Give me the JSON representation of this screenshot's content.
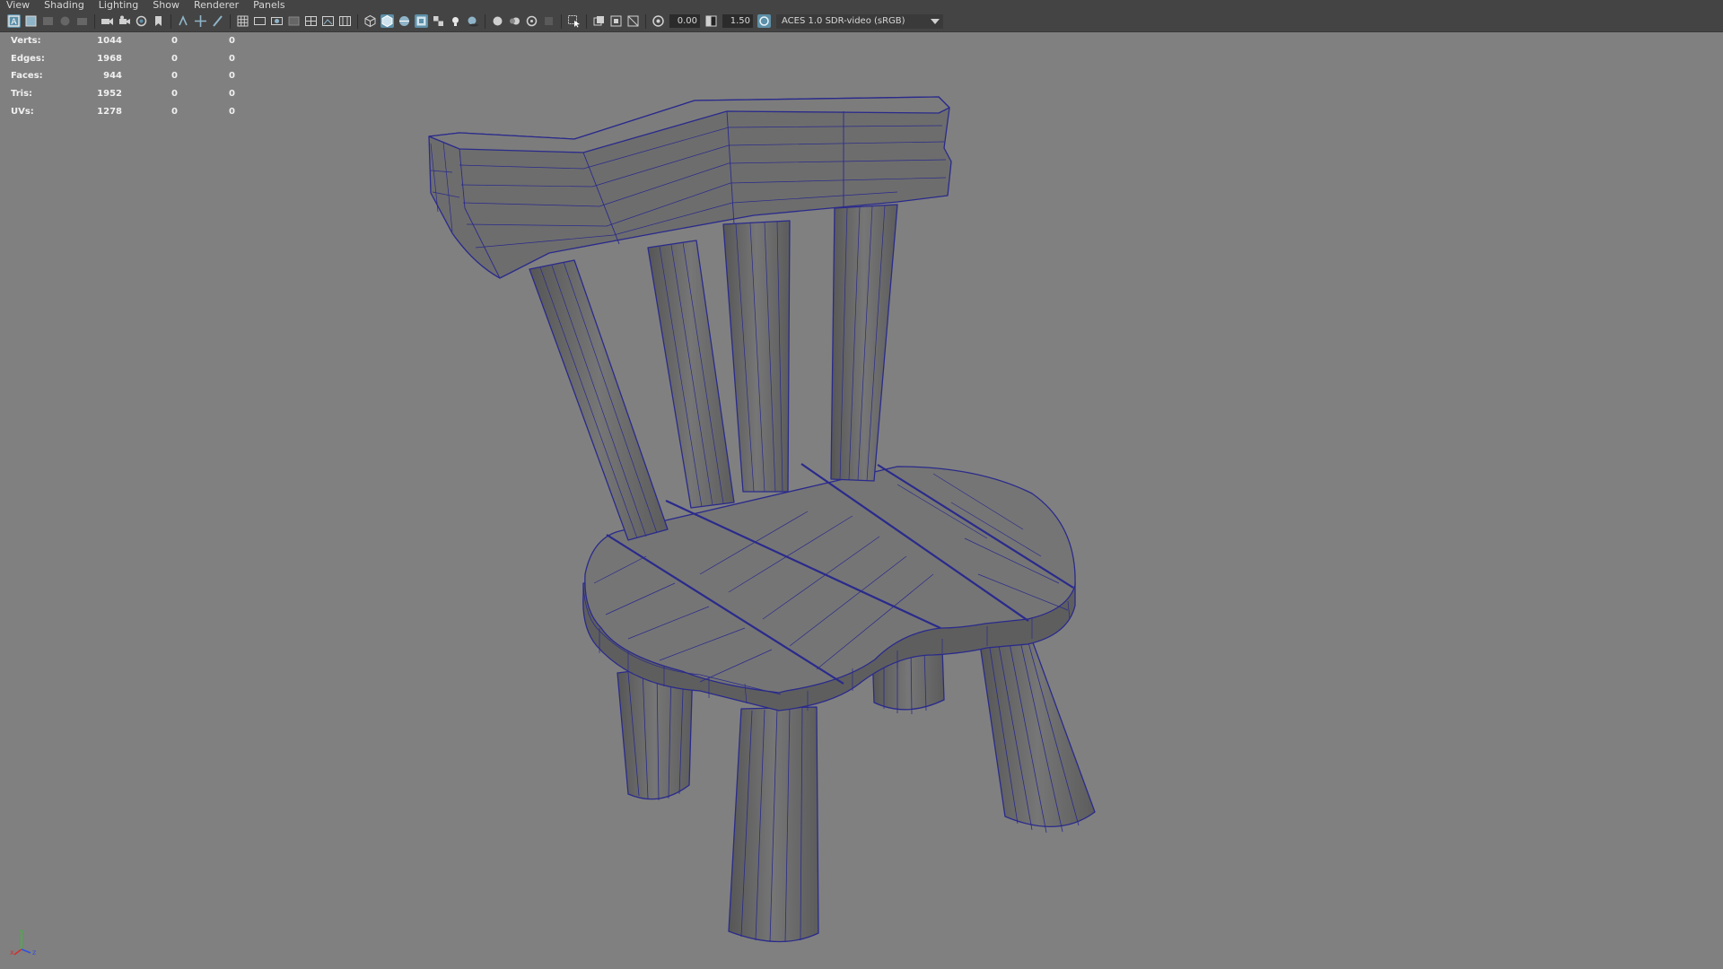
{
  "menu": {
    "items": [
      "View",
      "Shading",
      "Lighting",
      "Show",
      "Renderer",
      "Panels"
    ]
  },
  "toolbar": {
    "exposure_value": "0.00",
    "gamma_value": "1.50",
    "color_space_label": "ACES 1.0 SDR-video (sRGB)",
    "accent_color": "#5d8fa8",
    "icons": [
      "select-camera-icon",
      "camera-attributes-icon",
      "bookmark-icon",
      "image-plane-icon",
      "grid-icon",
      "film-gate-icon",
      "resolution-gate-icon",
      "gate-mask-icon",
      "field-chart-icon",
      "safe-action-icon",
      "safe-title-icon",
      "wireframe-icon",
      "smooth-shade-icon",
      "wireframe-on-shaded-icon",
      "textured-icon",
      "use-all-lights-icon",
      "shadows-icon",
      "screen-space-ao-icon",
      "motion-blur-icon",
      "anti-aliasing-icon",
      "depth-of-field-icon",
      "isolate-select-icon",
      "xray-icon",
      "xray-joints-icon",
      "xray-active-icon",
      "exposure-icon",
      "gamma-icon",
      "color-management-icon"
    ]
  },
  "hud": {
    "rows": [
      {
        "label": "Verts:",
        "v1": "1044",
        "v2": "0",
        "v3": "0"
      },
      {
        "label": "Edges:",
        "v1": "1968",
        "v2": "0",
        "v3": "0"
      },
      {
        "label": "Faces:",
        "v1": "944",
        "v2": "0",
        "v3": "0"
      },
      {
        "label": "Tris:",
        "v1": "1952",
        "v2": "0",
        "v3": "0"
      },
      {
        "label": "UVs:",
        "v1": "1278",
        "v2": "0",
        "v3": "0"
      }
    ]
  },
  "viewport": {
    "background_color": "#808080",
    "wireframe_color": "#2a2a8c",
    "model_color": "#6e6e6e",
    "model_name": "wooden-chair"
  },
  "axis_gizmo": {
    "x_label": "x",
    "y_label": "y",
    "z_label": "z"
  }
}
